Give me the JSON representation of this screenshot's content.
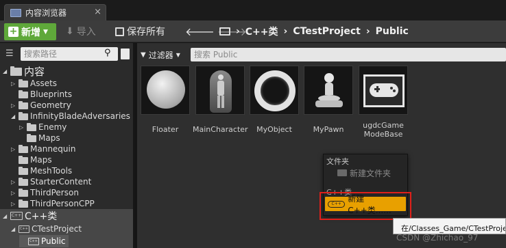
{
  "tab": {
    "title": "内容浏览器",
    "close": "×"
  },
  "toolbar": {
    "new_label": "新增",
    "import_label": "导入",
    "save_all_label": "保存所有",
    "breadcrumb": [
      "C++类",
      "CTestProject",
      "Public"
    ]
  },
  "left_panel": {
    "search_placeholder": "搜索路径",
    "tree": [
      {
        "label": "内容",
        "depth": 0,
        "expanded": true
      },
      {
        "label": "Assets",
        "depth": 1
      },
      {
        "label": "Blueprints",
        "depth": 1
      },
      {
        "label": "Geometry",
        "depth": 1
      },
      {
        "label": "InfinityBladeAdversaries",
        "depth": 1,
        "expanded": true
      },
      {
        "label": "Enemy",
        "depth": 2
      },
      {
        "label": "Maps",
        "depth": 2
      },
      {
        "label": "Mannequin",
        "depth": 1
      },
      {
        "label": "Maps",
        "depth": 1
      },
      {
        "label": "MeshTools",
        "depth": 1
      },
      {
        "label": "StarterContent",
        "depth": 1
      },
      {
        "label": "ThirdPerson",
        "depth": 1
      },
      {
        "label": "ThirdPersonCPP",
        "depth": 1
      },
      {
        "label": "C++类",
        "depth": 0,
        "expanded": true
      },
      {
        "label": "CTestProject",
        "depth": 1,
        "expanded": true
      },
      {
        "label": "Public",
        "depth": 2,
        "selected": true
      }
    ]
  },
  "right_panel": {
    "filter_label": "过滤器",
    "search_placeholder": "搜索 Public",
    "assets": [
      {
        "name": "Floater",
        "icon": "sphere-icon"
      },
      {
        "name": "MainCharacter",
        "icon": "mannequin-icon"
      },
      {
        "name": "MyObject",
        "icon": "ring-icon"
      },
      {
        "name": "MyPawn",
        "icon": "pawn-icon"
      },
      {
        "name": "ugdcGame ModeBase",
        "icon": "gamepad-icon"
      }
    ]
  },
  "context_menu": {
    "folder_header": "文件夹",
    "new_folder": "新建文件夹",
    "cpp_header": "C++类",
    "new_cpp_class": "新建C++类......"
  },
  "tooltip": "在/Classes_Game/CTestProject",
  "watermark": "CSDN @Zhichao_97",
  "colors": {
    "new_button": "#5fa83a",
    "highlight": "#e8a000",
    "annotation_box": "#e0201a"
  }
}
